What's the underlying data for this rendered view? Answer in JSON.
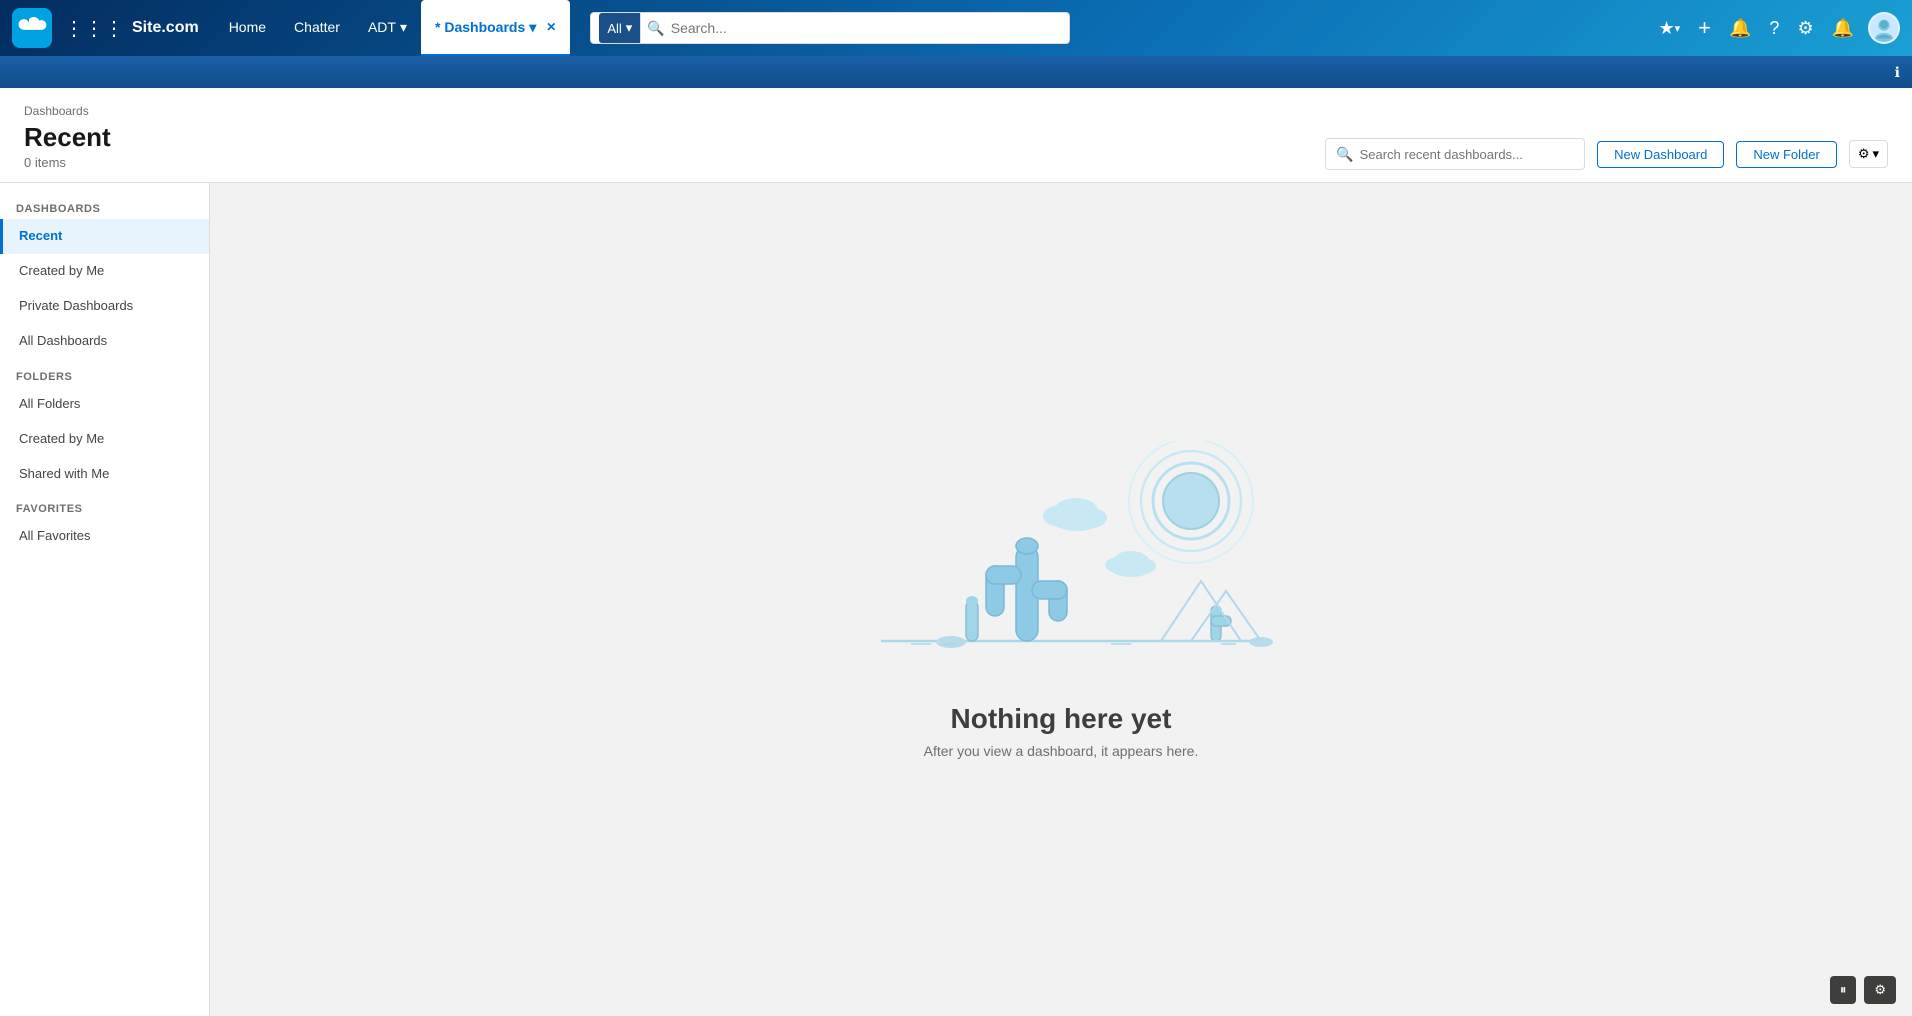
{
  "app": {
    "logo_text": "☁",
    "site_name": "Site.com"
  },
  "top_nav": {
    "nav_items": [
      {
        "label": "Home",
        "active": false
      },
      {
        "label": "Chatter",
        "active": false
      },
      {
        "label": "ADT",
        "active": false,
        "has_chevron": true
      },
      {
        "label": "* Dashboards",
        "active": true,
        "has_chevron": true,
        "closable": true
      }
    ],
    "search": {
      "dropdown_label": "All",
      "placeholder": "Search..."
    },
    "actions": {
      "favorites_label": "★",
      "add_label": "+",
      "notifications_label": "🔔",
      "help_label": "?",
      "settings_label": "⚙"
    }
  },
  "page_header": {
    "breadcrumb": "Dashboards",
    "title": "Recent",
    "item_count": "0 items",
    "search_placeholder": "Search recent dashboards...",
    "new_dashboard_label": "New Dashboard",
    "new_folder_label": "New Folder"
  },
  "sidebar": {
    "dashboards_section_label": "DASHBOARDS",
    "dashboards_items": [
      {
        "label": "Recent",
        "active": true
      },
      {
        "label": "Created by Me",
        "active": false
      },
      {
        "label": "Private Dashboards",
        "active": false
      },
      {
        "label": "All Dashboards",
        "active": false
      }
    ],
    "folders_section_label": "FOLDERS",
    "folders_items": [
      {
        "label": "All Folders",
        "active": false
      },
      {
        "label": "Created by Me",
        "active": false
      },
      {
        "label": "Shared with Me",
        "active": false
      }
    ],
    "favorites_section_label": "FAVORITES",
    "favorites_items": [
      {
        "label": "All Favorites",
        "active": false
      }
    ]
  },
  "empty_state": {
    "title": "Nothing here yet",
    "subtitle": "After you view a dashboard, it appears here."
  },
  "bottom_bar": {
    "pause_label": "⏸",
    "settings_label": "⚙"
  }
}
